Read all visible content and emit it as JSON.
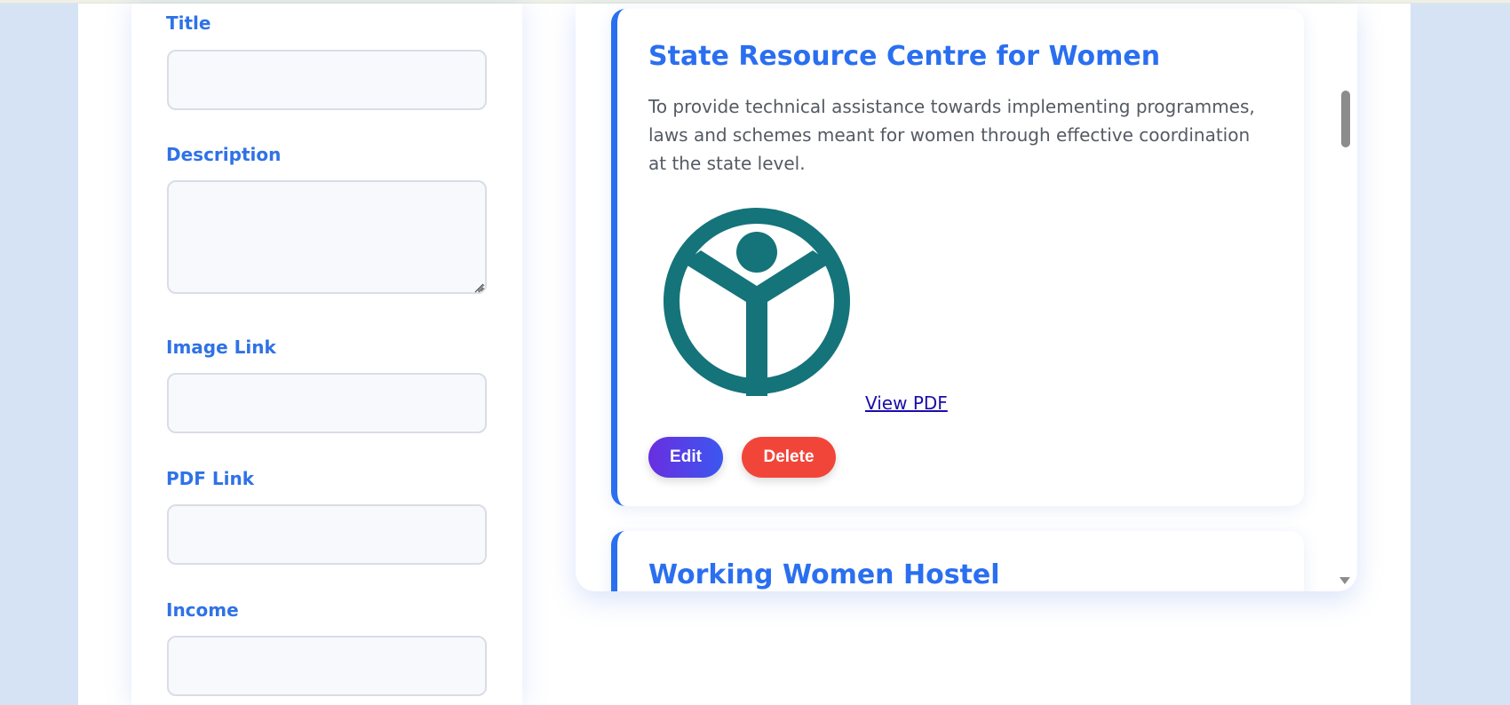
{
  "form": {
    "fields": [
      {
        "label": "Title",
        "value": "",
        "placeholder": ""
      },
      {
        "label": "Description",
        "value": "",
        "placeholder": ""
      },
      {
        "label": "Image Link",
        "value": "",
        "placeholder": ""
      },
      {
        "label": "PDF Link",
        "value": "",
        "placeholder": ""
      },
      {
        "label": "Income",
        "value": "",
        "placeholder": ""
      }
    ]
  },
  "schemes": [
    {
      "title": "State Resource Centre for Women",
      "description": "To provide technical assistance towards implementing programmes, laws and schemes meant for women through effective coordination at the state level.",
      "logo_icon": "women-empowerment-logo-icon",
      "pdf_label": "View PDF",
      "edit_label": "Edit",
      "delete_label": "Delete"
    },
    {
      "title": "Working Women Hostel"
    }
  ],
  "colors": {
    "accent": "#2a6ff0",
    "label": "#2f72e6",
    "logo": "#15737a",
    "delete": "#f2453a",
    "edit_start": "#6a2ee0",
    "edit_end": "#3b57ef",
    "background": "#d6e3f5"
  }
}
